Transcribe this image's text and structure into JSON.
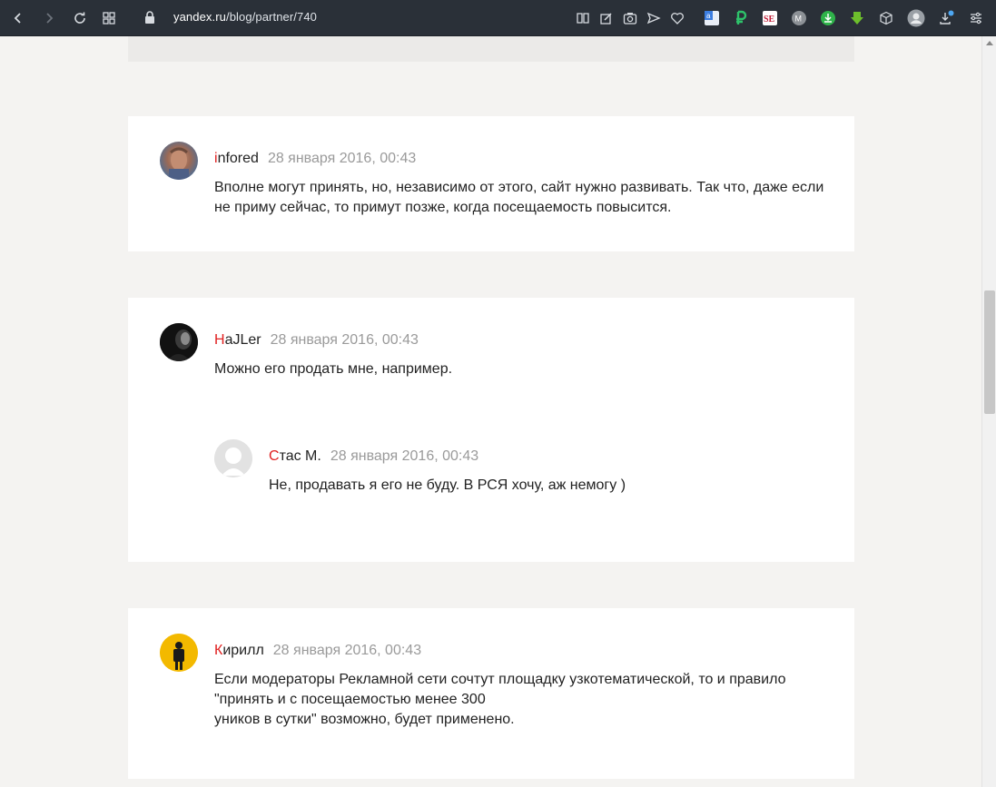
{
  "browser": {
    "url_domain": "yandex.ru",
    "url_path": "/blog/partner/740",
    "toolbar_icons": [
      "back-icon",
      "forward-icon",
      "reload-icon",
      "tabs-grid-icon",
      "lock-icon",
      "reader-icon",
      "edit-icon",
      "camera-icon",
      "send-icon",
      "heart-icon",
      "translate-extension-icon",
      "ruble-extension-icon",
      "se-extension-icon",
      "m-extension-icon",
      "download-green-icon",
      "arrow-down-extension-icon",
      "cube-icon",
      "profile-icon",
      "downloads-icon",
      "settings-icon"
    ]
  },
  "comments": [
    {
      "author_first": "i",
      "author_rest": "nfored",
      "date": "28 января 2016, 00:43",
      "text": "Вполне могут принять, но, независимо от этого, сайт нужно развивать. Так что, даже если\nне приму сейчас, то примут позже, когда посещаемость повысится."
    },
    {
      "author_first": "H",
      "author_rest": "aJLer",
      "date": "28 января 2016, 00:43",
      "text": "Можно его продать мне, например.",
      "reply": {
        "author_first": "С",
        "author_rest": "тас М.",
        "date": "28 января 2016, 00:43",
        "text": "Не, продавать я его не буду. В РСЯ хочу, аж немогу )"
      }
    },
    {
      "author_first": "К",
      "author_rest": "ирилл",
      "date": "28 января 2016, 00:43",
      "text": "Если модераторы Рекламной сети сочтут площадку узкотематической, то и правило\n\"принять и с посещаемостью менее 300\nуников  в сутки\" возможно, будет применено."
    }
  ],
  "colors": {
    "author_accent": "#e01f1f",
    "page_bg": "#f4f3f1",
    "toolbar_bg": "#2a3038"
  }
}
